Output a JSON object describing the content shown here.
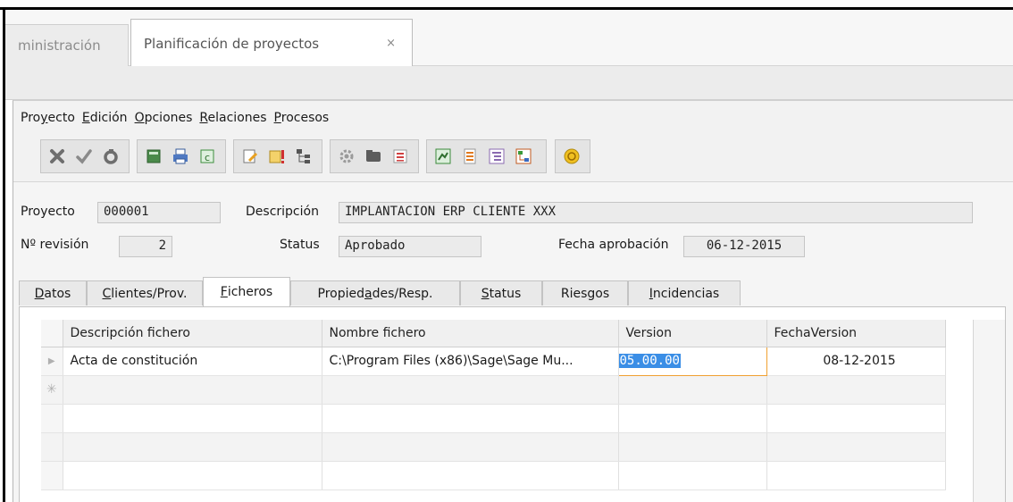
{
  "tabs": [
    {
      "label": "ministración"
    },
    {
      "label": "Planificación de proyectos",
      "close": "×"
    }
  ],
  "menu": [
    {
      "label": "Proyecto",
      "accel": "y"
    },
    {
      "label": "Edición",
      "accel": "E"
    },
    {
      "label": "Opciones",
      "accel": "O"
    },
    {
      "label": "Relaciones",
      "accel": "R"
    },
    {
      "label": "Procesos",
      "accel": "P"
    }
  ],
  "toolbar_icons": [
    "delete-icon",
    "confirm-icon",
    "undo-icon",
    "calculator-icon",
    "print-icon",
    "export-icon",
    "edit-doc-icon",
    "alert-doc-icon",
    "tree-icon",
    "settings-icon",
    "folder-icon",
    "list-icon",
    "chart-icon",
    "document-icon",
    "outline-icon",
    "diagram-icon",
    "currency-icon"
  ],
  "form": {
    "proyecto_label": "Proyecto",
    "proyecto_value": "000001",
    "descripcion_label": "Descripción",
    "descripcion_value": "IMPLANTACION ERP CLIENTE XXX",
    "revision_label": "Nº revisión",
    "revision_value": "2",
    "status_label": "Status",
    "status_value": "Aprobado",
    "fecha_label": "Fecha aprobación",
    "fecha_value": "06-12-2015"
  },
  "subtabs": [
    {
      "label": "Datos"
    },
    {
      "label": "Clientes/Prov."
    },
    {
      "label": "Ficheros",
      "active": true
    },
    {
      "label": "Propiedades/Resp."
    },
    {
      "label": "Status"
    },
    {
      "label": "Riesgos"
    },
    {
      "label": "Incidencias"
    }
  ],
  "grid": {
    "columns": [
      "Descripción fichero",
      "Nombre fichero",
      "Version",
      "FechaVersion"
    ],
    "rows": [
      {
        "indicator": "▶",
        "descripcion": "Acta de constitución",
        "nombre": "C:\\Program Files (x86)\\Sage\\Sage Mu...",
        "version": "05.00.00",
        "fecha": "08-12-2015"
      }
    ],
    "new_row_indicator": "✳"
  },
  "colors": {
    "accent_selection": "#3a8ee6",
    "edit_border": "#f0a030"
  }
}
